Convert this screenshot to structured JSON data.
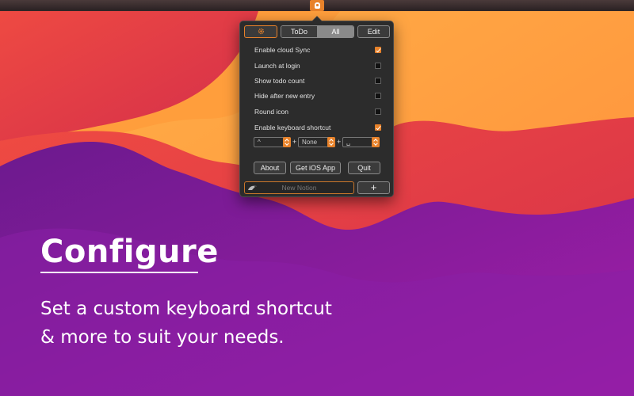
{
  "popover": {
    "tabs": [
      {
        "label": "ToDo"
      },
      {
        "label": "All"
      }
    ],
    "edit_label": "Edit",
    "settings": [
      {
        "label": "Enable cloud Sync",
        "checked": true
      },
      {
        "label": "Launch at login",
        "checked": false
      },
      {
        "label": "Show todo count",
        "checked": false
      },
      {
        "label": "Hide after new entry",
        "checked": false
      },
      {
        "label": "Round icon",
        "checked": false
      },
      {
        "label": "Enable keyboard shortcut",
        "checked": true
      }
    ],
    "shortcut": {
      "modifier1": "^",
      "modifier2": "None",
      "key": "␣",
      "plus": "+"
    },
    "about_label": "About",
    "ios_label": "Get iOS App",
    "quit_label": "Quit",
    "new_placeholder": "New Notion",
    "add_label": "+"
  },
  "headline": "Configure",
  "subtitle_line1": "Set a custom keyboard shortcut",
  "subtitle_line2": "& more to suit your needs.",
  "colors": {
    "accent": "#e8822a",
    "popover_bg": "#2c2c2c",
    "bg_orange": "#ffa640",
    "bg_red": "#e83a3a",
    "bg_purple": "#7a1a9c"
  }
}
